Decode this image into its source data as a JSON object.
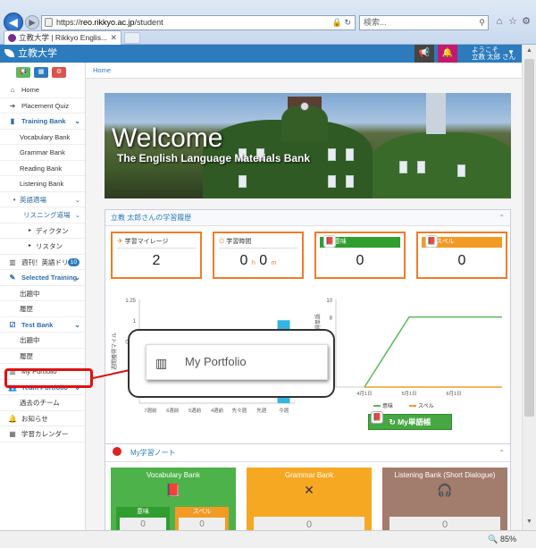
{
  "browser": {
    "url_prefix": "https://",
    "url_host": "reo.rikkyo.ac.jp",
    "url_path": "/student",
    "url_tail": "🔒 ↻",
    "search_placeholder": "検索...",
    "tab_title": "立教大学 | Rikkyo Englis...",
    "zoom": "🔍 85%"
  },
  "app": {
    "logo": "立教大学",
    "user_greeting": "ようこそ",
    "user_name": "立教 太郎 さん",
    "breadcrumb": "Home"
  },
  "sidebar": {
    "items": [
      {
        "label": "Home",
        "icon": "home-icon"
      },
      {
        "label": "Placement Quiz",
        "icon": "arrow-right-icon"
      },
      {
        "label": "Training Bank",
        "icon": "book-icon"
      },
      {
        "label": "Vocabulary Bank"
      },
      {
        "label": "Grammar Bank"
      },
      {
        "label": "Reading Bank"
      },
      {
        "label": "Listening Bank"
      },
      {
        "label": "英語適場"
      },
      {
        "label": "リスニング道場"
      },
      {
        "label": "ディクタン"
      },
      {
        "label": "リスタン"
      },
      {
        "label": "週刊！英語ドリル",
        "badge": "10"
      },
      {
        "label": "Selected Training"
      },
      {
        "label": "出題中"
      },
      {
        "label": "履歴"
      },
      {
        "label": "Test Bank"
      },
      {
        "label": "出題中"
      },
      {
        "label": "履歴"
      },
      {
        "label": "My Portfolio"
      },
      {
        "label": "Team Portfolio"
      },
      {
        "label": "過去のチーム"
      },
      {
        "label": "お知らせ"
      },
      {
        "label": "学習カレンダー"
      }
    ]
  },
  "hero": {
    "welcome": "Welcome",
    "subtitle": "The English Language Materials Bank"
  },
  "history": {
    "title": "立教 太郎さんの学習履歴",
    "stats": [
      {
        "label": "学習マイレージ",
        "value": "2"
      },
      {
        "label": "学習時間",
        "hours": "0",
        "h_unit": "h",
        "minutes": "0",
        "m_unit": "m"
      },
      {
        "label": "意味",
        "value": "0",
        "color": "#2f9e2f"
      },
      {
        "label": "スペル",
        "value": "0",
        "color": "#f39a25"
      }
    ],
    "tango_button": "My単語帳"
  },
  "chart_data": [
    {
      "type": "bar",
      "ylabel": "週間獲得マイル",
      "ylim": [
        0,
        1.25
      ],
      "yticks": [
        "1.25",
        "1",
        "0.75"
      ],
      "categories": [
        "7週前",
        "6週前",
        "5週前",
        "4週前",
        "先々週",
        "先週",
        "今週"
      ],
      "values": [
        0,
        0,
        0,
        0,
        0,
        0,
        1
      ],
      "color": "#33b5e5"
    },
    {
      "type": "line",
      "ylabel": "獲得単語",
      "ylim": [
        0,
        10
      ],
      "yticks": [
        "10",
        "8"
      ],
      "x": [
        "4月1日",
        "5月1日",
        "6月1日"
      ],
      "series": [
        {
          "name": "意味",
          "values": [
            0,
            8,
            8,
            8
          ],
          "color": "#5cb85c"
        },
        {
          "name": "スペル",
          "values": [
            0,
            0,
            0,
            0
          ],
          "color": "#f39a25"
        }
      ]
    }
  ],
  "popup": {
    "label": "My Portfolio"
  },
  "note": {
    "title": "My学習ノート",
    "banks": [
      {
        "name": "Vocabulary Bank",
        "color": "#4db24a",
        "left_label": "意味",
        "right_label": "スペル",
        "left_value": "0",
        "right_value": "0"
      },
      {
        "name": "Grammar Bank",
        "color": "#f7a823",
        "value": "0"
      },
      {
        "name": "Listening Bank (Short Dialogue)",
        "color": "#a27c6c",
        "value": "0"
      }
    ]
  }
}
